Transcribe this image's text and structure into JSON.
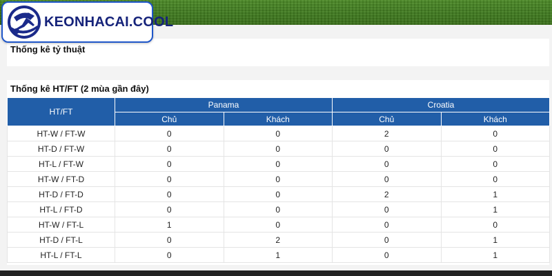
{
  "logo": {
    "brand": "KEONHACAI.COOL"
  },
  "colors": {
    "header_blue": "#215ea8",
    "logo_border": "#1f56c9",
    "brand_text": "#16237a",
    "grass": "#3f7a1f"
  },
  "odds_section": {
    "title": "Thống kê tỷ thuật"
  },
  "htft_section": {
    "title": "Thống kê HT/FT (2 mùa gần đây)",
    "header": {
      "htft": "HT/FT",
      "team_a": "Panama",
      "team_b": "Croatia",
      "home": "Chủ",
      "away": "Khách"
    },
    "rows": [
      {
        "label": "HT-W / FT-W",
        "values": [
          "0",
          "0",
          "2",
          "0"
        ]
      },
      {
        "label": "HT-D / FT-W",
        "values": [
          "0",
          "0",
          "0",
          "0"
        ]
      },
      {
        "label": "HT-L / FT-W",
        "values": [
          "0",
          "0",
          "0",
          "0"
        ]
      },
      {
        "label": "HT-W / FT-D",
        "values": [
          "0",
          "0",
          "0",
          "0"
        ]
      },
      {
        "label": "HT-D / FT-D",
        "values": [
          "0",
          "0",
          "2",
          "1"
        ]
      },
      {
        "label": "HT-L / FT-D",
        "values": [
          "0",
          "0",
          "0",
          "1"
        ]
      },
      {
        "label": "HT-W / FT-L",
        "values": [
          "1",
          "0",
          "0",
          "0"
        ]
      },
      {
        "label": "HT-D / FT-L",
        "values": [
          "0",
          "2",
          "0",
          "1"
        ]
      },
      {
        "label": "HT-L / FT-L",
        "values": [
          "0",
          "1",
          "0",
          "1"
        ]
      }
    ]
  }
}
